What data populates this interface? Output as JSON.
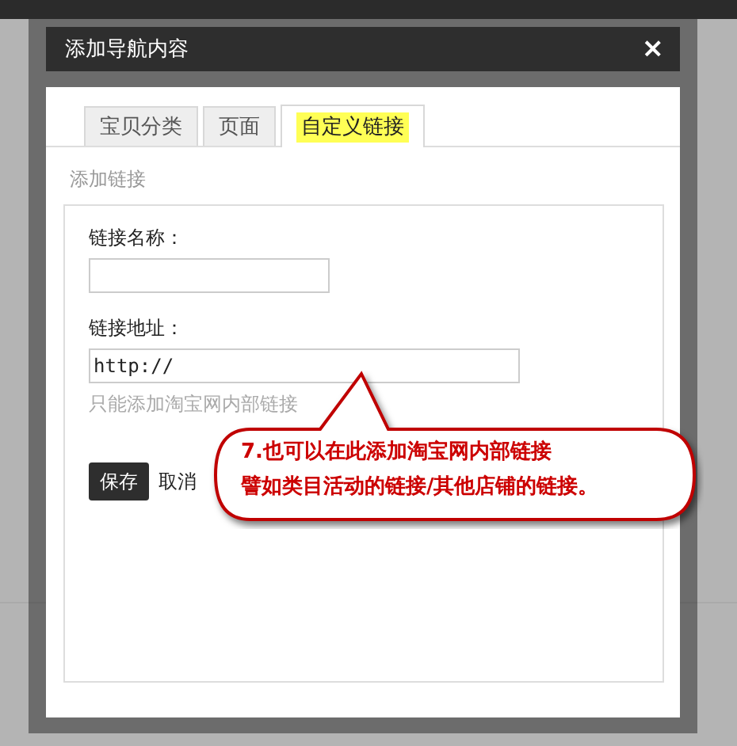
{
  "dialog": {
    "title": "添加导航内容",
    "close": "×",
    "tabs": [
      {
        "label": "宝贝分类",
        "selected": false
      },
      {
        "label": "页面",
        "selected": false
      },
      {
        "label": "自定义链接",
        "selected": true
      }
    ],
    "section_title": "添加链接",
    "fields": [
      {
        "label": "链接名称："
      },
      {
        "label": "链接地址：",
        "value": "http://",
        "hint": "只能添加淘宝网内部链接"
      }
    ],
    "buttons": [
      {
        "label": "保存",
        "kind": "primary"
      },
      {
        "label": "取消",
        "kind": "link"
      }
    ]
  },
  "callout": {
    "lines": [
      "7.也可以在此添加淘宝网内部链接",
      "譬如类目活动的链接/其他店铺的链接。"
    ]
  }
}
